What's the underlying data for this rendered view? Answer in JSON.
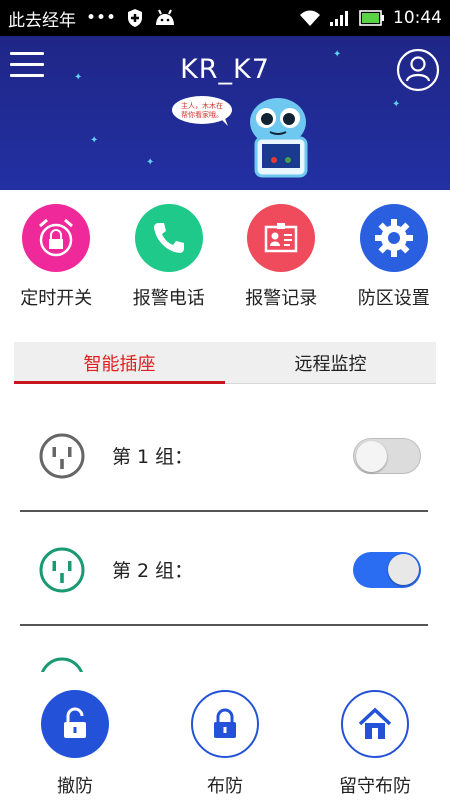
{
  "status_bar": {
    "carrier": "此去经年",
    "dots": "•••",
    "time": "10:44"
  },
  "header": {
    "title": "KR_K7",
    "speech_bubble": "主人，木木在帮你看家哦。",
    "colors": {
      "background": "#2230a2",
      "accent": "#5fd2f0"
    }
  },
  "quick_actions": [
    {
      "label": "定时开关",
      "icon": "alarm-clock-icon",
      "color": "#f0299a"
    },
    {
      "label": "报警电话",
      "icon": "phone-icon",
      "color": "#1ec98a"
    },
    {
      "label": "报警记录",
      "icon": "id-card-icon",
      "color": "#ef4b5c"
    },
    {
      "label": "防区设置",
      "icon": "gear-icon",
      "color": "#2a5fe0"
    }
  ],
  "tabs": [
    {
      "label": "智能插座",
      "active": true
    },
    {
      "label": "远程监控",
      "active": false
    }
  ],
  "sockets": [
    {
      "name": "第 1 组：",
      "on": false,
      "icon_color": "#666666"
    },
    {
      "name": "第 2 组：",
      "on": true,
      "icon_color": "#1a9a72"
    }
  ],
  "bottom_actions": [
    {
      "label": "撤防",
      "icon": "unlock-icon"
    },
    {
      "label": "布防",
      "icon": "lock-icon"
    },
    {
      "label": "留守布防",
      "icon": "home-icon"
    }
  ]
}
